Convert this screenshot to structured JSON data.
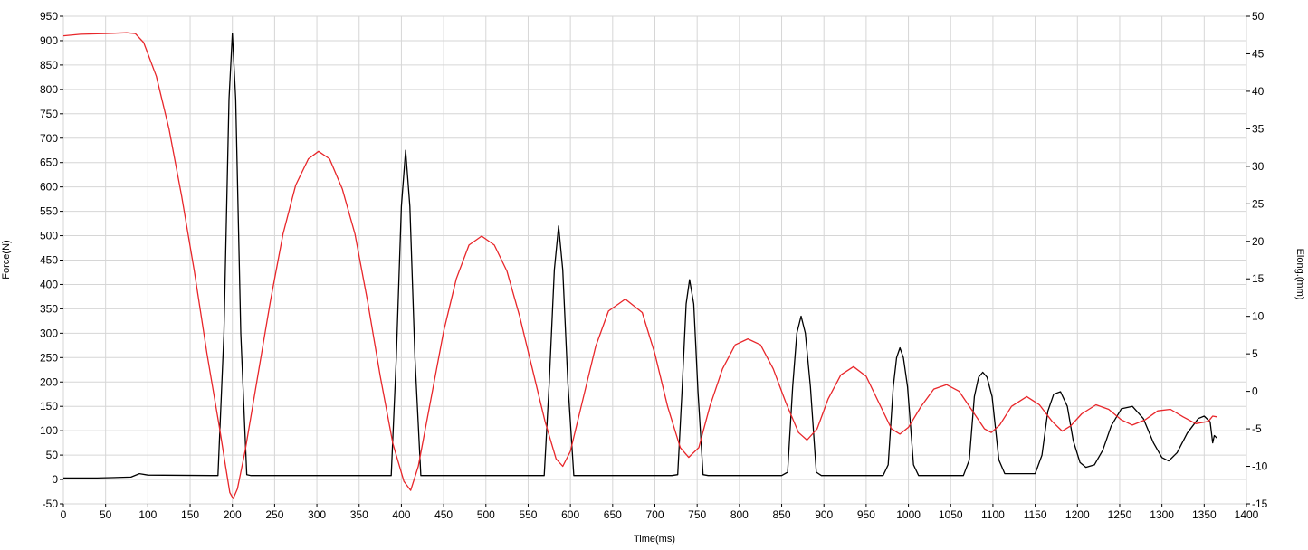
{
  "chart_data": {
    "type": "line",
    "title": "",
    "xlabel": "Time(ms)",
    "ylabel_left": "Force(N)",
    "ylabel_right": "Elong.(mm)",
    "xlim": [
      0,
      1400
    ],
    "ylim_left": [
      -50,
      950
    ],
    "ylim_right": [
      -15,
      50
    ],
    "x_ticks": [
      0,
      50,
      100,
      150,
      200,
      250,
      300,
      350,
      400,
      450,
      500,
      550,
      600,
      650,
      700,
      750,
      800,
      850,
      900,
      950,
      1000,
      1050,
      1100,
      1150,
      1200,
      1250,
      1300,
      1350,
      1400
    ],
    "y_ticks_left": [
      -50,
      0,
      50,
      100,
      150,
      200,
      250,
      300,
      350,
      400,
      450,
      500,
      550,
      600,
      650,
      700,
      750,
      800,
      850,
      900,
      950
    ],
    "y_ticks_right": [
      -15,
      -10,
      -5,
      0,
      5,
      10,
      15,
      20,
      25,
      30,
      35,
      40,
      45,
      50
    ],
    "grid": true,
    "colors": {
      "force": "#000000",
      "elong": "#e8262a",
      "grid": "#d6d6d6"
    },
    "series": [
      {
        "axis": "left",
        "color": "#000000",
        "points": [
          [
            0,
            3
          ],
          [
            40,
            3
          ],
          [
            80,
            5
          ],
          [
            90,
            12
          ],
          [
            100,
            9
          ],
          [
            175,
            8
          ],
          [
            183,
            8
          ],
          [
            190,
            300
          ],
          [
            196,
            780
          ],
          [
            200,
            915
          ],
          [
            204,
            780
          ],
          [
            210,
            300
          ],
          [
            217,
            10
          ],
          [
            222,
            8
          ],
          [
            380,
            8
          ],
          [
            388,
            8
          ],
          [
            394,
            250
          ],
          [
            400,
            560
          ],
          [
            405,
            675
          ],
          [
            410,
            560
          ],
          [
            416,
            250
          ],
          [
            423,
            8
          ],
          [
            428,
            8
          ],
          [
            560,
            8
          ],
          [
            569,
            8
          ],
          [
            575,
            200
          ],
          [
            581,
            430
          ],
          [
            586,
            520
          ],
          [
            591,
            430
          ],
          [
            597,
            200
          ],
          [
            604,
            8
          ],
          [
            610,
            8
          ],
          [
            720,
            8
          ],
          [
            727,
            10
          ],
          [
            732,
            180
          ],
          [
            737,
            360
          ],
          [
            741,
            410
          ],
          [
            746,
            360
          ],
          [
            751,
            180
          ],
          [
            757,
            10
          ],
          [
            763,
            8
          ],
          [
            850,
            8
          ],
          [
            857,
            15
          ],
          [
            863,
            190
          ],
          [
            868,
            300
          ],
          [
            873,
            335
          ],
          [
            878,
            300
          ],
          [
            884,
            190
          ],
          [
            891,
            15
          ],
          [
            897,
            8
          ],
          [
            970,
            8
          ],
          [
            976,
            30
          ],
          [
            982,
            190
          ],
          [
            986,
            250
          ],
          [
            990,
            270
          ],
          [
            994,
            250
          ],
          [
            999,
            190
          ],
          [
            1006,
            30
          ],
          [
            1012,
            8
          ],
          [
            1065,
            8
          ],
          [
            1072,
            40
          ],
          [
            1078,
            170
          ],
          [
            1083,
            210
          ],
          [
            1088,
            220
          ],
          [
            1093,
            210
          ],
          [
            1099,
            170
          ],
          [
            1107,
            40
          ],
          [
            1114,
            12
          ],
          [
            1122,
            12
          ],
          [
            1150,
            12
          ],
          [
            1158,
            50
          ],
          [
            1165,
            140
          ],
          [
            1172,
            175
          ],
          [
            1180,
            180
          ],
          [
            1188,
            150
          ],
          [
            1195,
            80
          ],
          [
            1203,
            35
          ],
          [
            1210,
            25
          ],
          [
            1220,
            30
          ],
          [
            1230,
            60
          ],
          [
            1240,
            110
          ],
          [
            1252,
            145
          ],
          [
            1265,
            150
          ],
          [
            1278,
            125
          ],
          [
            1290,
            75
          ],
          [
            1300,
            45
          ],
          [
            1308,
            38
          ],
          [
            1318,
            55
          ],
          [
            1330,
            95
          ],
          [
            1343,
            125
          ],
          [
            1350,
            130
          ],
          [
            1357,
            118
          ],
          [
            1360,
            75
          ],
          [
            1362,
            90
          ],
          [
            1365,
            85
          ]
        ]
      },
      {
        "axis": "right",
        "color": "#e8262a",
        "points": [
          [
            0,
            47.4
          ],
          [
            20,
            47.6
          ],
          [
            50,
            47.7
          ],
          [
            75,
            47.8
          ],
          [
            85,
            47.7
          ],
          [
            95,
            46.5
          ],
          [
            110,
            42
          ],
          [
            125,
            35
          ],
          [
            140,
            26
          ],
          [
            155,
            16
          ],
          [
            170,
            5
          ],
          [
            185,
            -5
          ],
          [
            192,
            -10
          ],
          [
            197,
            -13.5
          ],
          [
            201,
            -14.3
          ],
          [
            206,
            -13
          ],
          [
            215,
            -8
          ],
          [
            230,
            2
          ],
          [
            245,
            12
          ],
          [
            260,
            21
          ],
          [
            275,
            27.5
          ],
          [
            290,
            31
          ],
          [
            302,
            32
          ],
          [
            315,
            31
          ],
          [
            330,
            27
          ],
          [
            345,
            21
          ],
          [
            360,
            12
          ],
          [
            375,
            2
          ],
          [
            390,
            -7
          ],
          [
            403,
            -12
          ],
          [
            411,
            -13.2
          ],
          [
            420,
            -10
          ],
          [
            435,
            -1
          ],
          [
            450,
            8
          ],
          [
            465,
            15
          ],
          [
            480,
            19.5
          ],
          [
            495,
            20.7
          ],
          [
            510,
            19.5
          ],
          [
            525,
            16
          ],
          [
            540,
            10
          ],
          [
            555,
            3
          ],
          [
            570,
            -4
          ],
          [
            583,
            -9
          ],
          [
            591,
            -10
          ],
          [
            600,
            -8
          ],
          [
            615,
            -1
          ],
          [
            630,
            6
          ],
          [
            645,
            10.7
          ],
          [
            665,
            12.3
          ],
          [
            685,
            10.5
          ],
          [
            700,
            5
          ],
          [
            715,
            -2
          ],
          [
            730,
            -7.5
          ],
          [
            740,
            -8.8
          ],
          [
            752,
            -7.5
          ],
          [
            765,
            -2
          ],
          [
            780,
            3
          ],
          [
            795,
            6.2
          ],
          [
            810,
            7
          ],
          [
            825,
            6.2
          ],
          [
            840,
            3
          ],
          [
            855,
            -1.5
          ],
          [
            870,
            -5.5
          ],
          [
            880,
            -6.5
          ],
          [
            892,
            -5
          ],
          [
            905,
            -1
          ],
          [
            920,
            2.2
          ],
          [
            935,
            3.3
          ],
          [
            950,
            2
          ],
          [
            965,
            -1.5
          ],
          [
            980,
            -5
          ],
          [
            990,
            -5.7
          ],
          [
            1000,
            -4.8
          ],
          [
            1015,
            -2
          ],
          [
            1030,
            0.3
          ],
          [
            1045,
            0.9
          ],
          [
            1060,
            0
          ],
          [
            1075,
            -2.5
          ],
          [
            1090,
            -5
          ],
          [
            1098,
            -5.5
          ],
          [
            1108,
            -4.5
          ],
          [
            1122,
            -2
          ],
          [
            1140,
            -0.7
          ],
          [
            1155,
            -1.8
          ],
          [
            1170,
            -4
          ],
          [
            1182,
            -5.3
          ],
          [
            1192,
            -4.6
          ],
          [
            1205,
            -3
          ],
          [
            1222,
            -1.8
          ],
          [
            1237,
            -2.4
          ],
          [
            1252,
            -3.8
          ],
          [
            1265,
            -4.5
          ],
          [
            1280,
            -3.8
          ],
          [
            1295,
            -2.6
          ],
          [
            1310,
            -2.4
          ],
          [
            1325,
            -3.4
          ],
          [
            1340,
            -4.3
          ],
          [
            1355,
            -4
          ],
          [
            1360,
            -3.3
          ],
          [
            1365,
            -3.4
          ]
        ]
      }
    ]
  }
}
